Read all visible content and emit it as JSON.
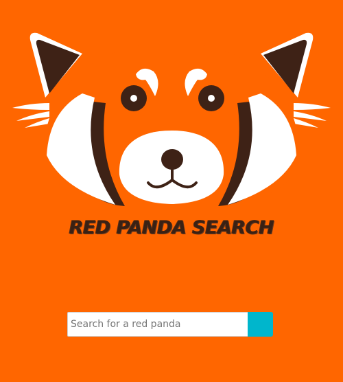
{
  "brand": {
    "title": "RED PANDA SEARCH",
    "logo_icon": "red-panda-face-icon"
  },
  "search": {
    "placeholder": "Search for a red panda",
    "value": "",
    "button_label": "",
    "button_icon": "none"
  },
  "colors": {
    "background": "#ff6600",
    "panda_orange": "#ff6600",
    "panda_dark": "#3e2216",
    "panda_white": "#ffffff",
    "title_text": "#3a2114",
    "search_button": "#00b6cc"
  }
}
